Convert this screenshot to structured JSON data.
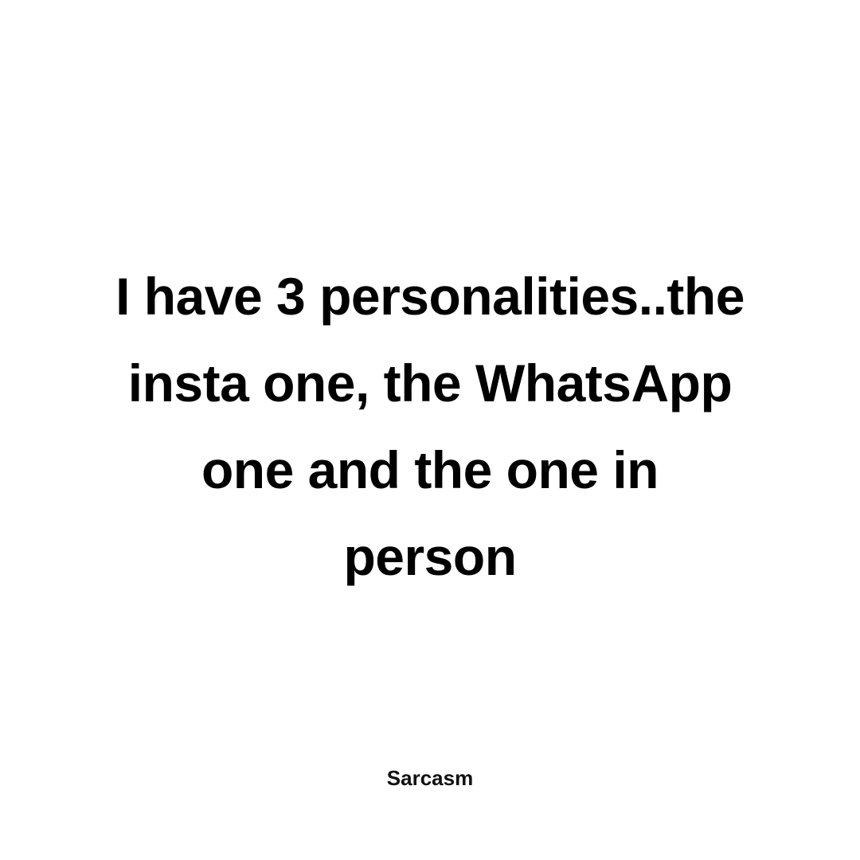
{
  "quote": {
    "lines": [
      "I have 3 personalities..the",
      "insta one, the WhatsApp",
      "one and the one in",
      "person"
    ]
  },
  "credit": {
    "label": "Sarcasm"
  },
  "colors": {
    "background": "#ffffff",
    "text": "#000000"
  }
}
